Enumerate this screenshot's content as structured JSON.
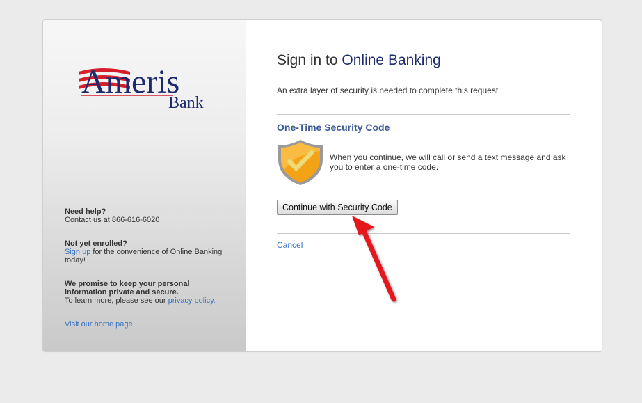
{
  "brand": {
    "logo_word": "Ameris",
    "logo_sub": "Bank"
  },
  "sidebar": {
    "help_heading": "Need help?",
    "help_contact": "Contact us at 866-616-6020",
    "enroll_heading": "Not yet enrolled?",
    "enroll_link": "Sign up",
    "enroll_text": " for the convenience of Online Banking today!",
    "privacy_heading": "We promise to keep your personal information private and secure.",
    "privacy_text": "To learn more, please see our ",
    "privacy_link": "privacy policy.",
    "home_link": "Visit our home page"
  },
  "main": {
    "title_prefix": "Sign in to ",
    "title_accent": "Online Banking",
    "subtitle": "An extra layer of security is needed to complete this request.",
    "section_title": "One-Time Security Code",
    "description": "When you continue, we will call or send a text message and ask you to enter a one-time code.",
    "continue_button": "Continue with Security Code",
    "cancel_link": "Cancel"
  },
  "icons": {
    "shield": "shield-check-icon",
    "arrow": "red-arrow-icon"
  },
  "colors": {
    "brand_navy": "#1d2a6e",
    "brand_red": "#d61f2b",
    "link": "#3a73c4",
    "section_title": "#3b5b97",
    "shield_orange": "#f5a316"
  }
}
